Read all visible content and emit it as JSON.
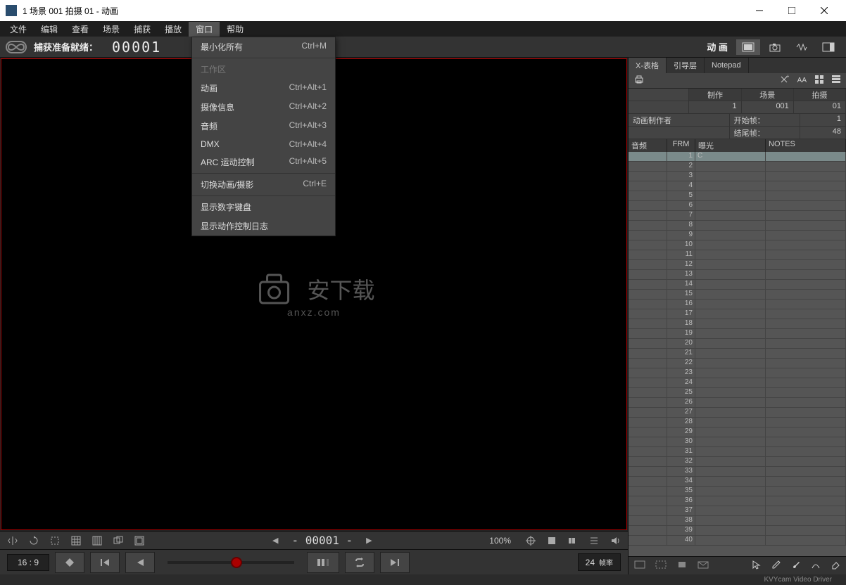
{
  "window": {
    "title": "1  场景 001  拍摄 01 - 动画"
  },
  "menubar": {
    "items": [
      "文件",
      "编辑",
      "查看",
      "场景",
      "捕获",
      "播放",
      "窗口",
      "帮助"
    ],
    "active_index": 6
  },
  "statusbar": {
    "ready": "捕获准备就绪：",
    "counter": "00001",
    "mode_label": "动 画"
  },
  "dropdown": {
    "groups": [
      [
        {
          "label": "最小化所有",
          "shortcut": "Ctrl+M",
          "disabled": false
        }
      ],
      [
        {
          "label": "工作区",
          "shortcut": "",
          "disabled": true
        },
        {
          "label": "动画",
          "shortcut": "Ctrl+Alt+1",
          "disabled": false
        },
        {
          "label": "摄像信息",
          "shortcut": "Ctrl+Alt+2",
          "disabled": false
        },
        {
          "label": "音频",
          "shortcut": "Ctrl+Alt+3",
          "disabled": false
        },
        {
          "label": "DMX",
          "shortcut": "Ctrl+Alt+4",
          "disabled": false
        },
        {
          "label": "ARC 运动控制",
          "shortcut": "Ctrl+Alt+5",
          "disabled": false
        }
      ],
      [
        {
          "label": "切换动画/摄影",
          "shortcut": "Ctrl+E",
          "disabled": false
        }
      ],
      [
        {
          "label": "显示数字键盘",
          "shortcut": "",
          "disabled": false
        },
        {
          "label": "显示动作控制日志",
          "shortcut": "",
          "disabled": false
        }
      ]
    ]
  },
  "watermark": {
    "brand": "安下载",
    "url": "anxz.com"
  },
  "toolbar1": {
    "frame": "- 00001 -",
    "zoom": "100%"
  },
  "toolbar2": {
    "aspect": "16 : 9",
    "fps_value": "24",
    "fps_label": "帧率"
  },
  "rightpanel": {
    "tabs": [
      "X-表格",
      "引导层",
      "Notepad"
    ],
    "active_tab": 0,
    "headers": {
      "h1": "制作",
      "h2": "场景",
      "h3": "拍摄",
      "v1": "1",
      "v2": "001",
      "v3": "01"
    },
    "maker_label": "动画制作者",
    "start_label": "开始帧：",
    "start_val": "1",
    "end_label": "结尾帧：",
    "end_val": "48",
    "sheet_headers": {
      "audio": "音频",
      "frm": "FRM",
      "expo": "曝光",
      "notes": "NOTES"
    },
    "row_count": 40,
    "exposure_mark": "C"
  },
  "bottom": {
    "driver": "KVYcam Video Driver"
  }
}
